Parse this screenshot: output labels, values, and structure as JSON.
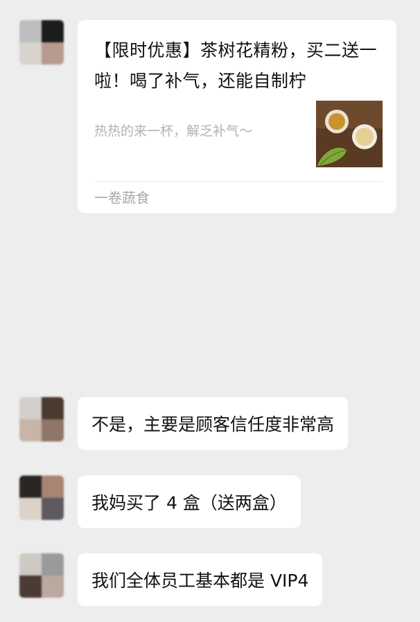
{
  "messages": [
    {
      "type": "link_card",
      "title": "【限时优惠】茶树花精粉，买二送一啦！喝了补气，还能自制柠",
      "description": "热热的来一杯，解乏补气～",
      "source": "一卷蔬食",
      "thumbnail_icon": "tea-cups-photo"
    },
    {
      "type": "text",
      "text": "不是，主要是顾客信任度非常高"
    },
    {
      "type": "text",
      "text": "我妈买了 4 盒（送两盒）"
    },
    {
      "type": "text",
      "text": "我们全体员工基本都是 VIP4"
    }
  ],
  "colors": {
    "background": "#ededed",
    "bubble": "#ffffff",
    "text": "#111111",
    "muted_text": "#b2b2b2"
  }
}
